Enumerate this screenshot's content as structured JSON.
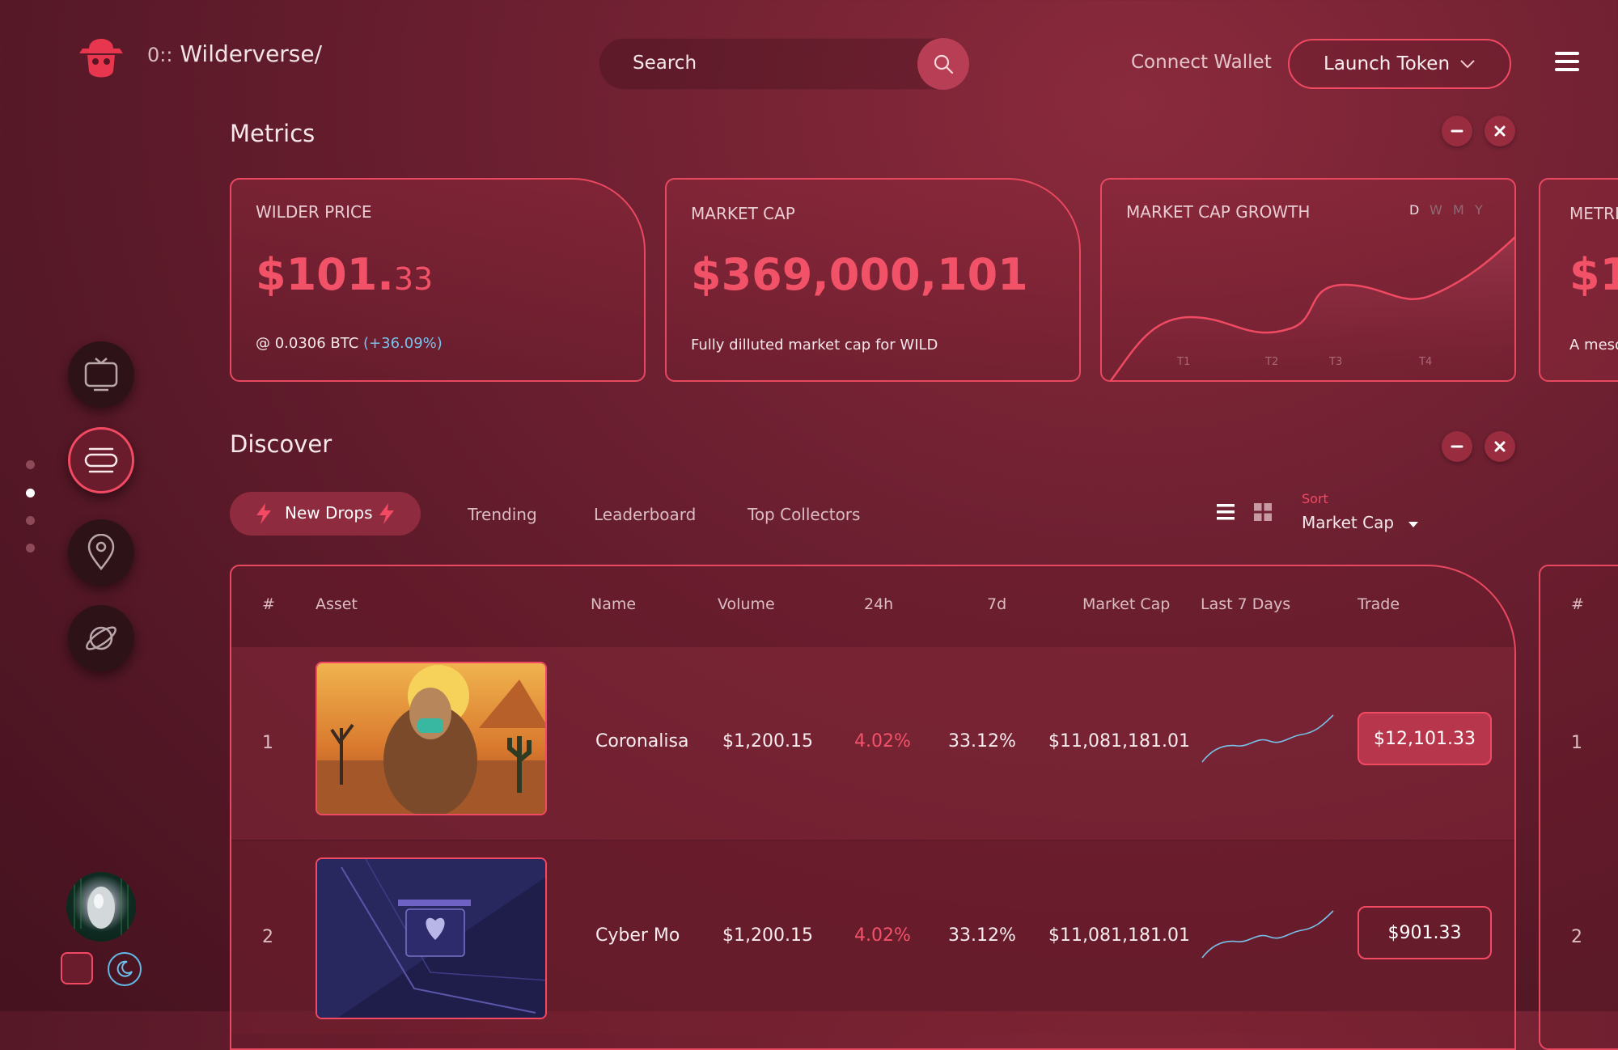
{
  "header": {
    "brand_prefix": "0::",
    "brand_name": "Wilderverse/",
    "search_placeholder": "Search",
    "connect_wallet": "Connect Wallet",
    "launch_token": "Launch Token"
  },
  "metrics": {
    "title": "Metrics",
    "cards": [
      {
        "label": "WILDER PRICE",
        "value_main": "$101.",
        "value_small": "33",
        "sub_prefix": "@ 0.0306 BTC",
        "sub_change": "(+36.09%)"
      },
      {
        "label": "MARKET CAP",
        "value": "$369,000,101",
        "sub": "Fully dilluted market cap for WILD"
      },
      {
        "label": "MARKET CAP GROWTH",
        "ranges": [
          "D",
          "W",
          "M",
          "Y"
        ],
        "active_range": "D",
        "x_labels": [
          "T1",
          "T2",
          "T3",
          "T4"
        ]
      },
      {
        "label": "METRI",
        "value": "$1",
        "sub": "A meso"
      }
    ]
  },
  "discover": {
    "title": "Discover",
    "tabs": [
      "New Drops",
      "Trending",
      "Leaderboard",
      "Top Collectors"
    ],
    "active_tab": "New Drops",
    "sort_label": "Sort",
    "sort_value": "Market Cap",
    "columns": [
      "#",
      "Asset",
      "Name",
      "Volume",
      "24h",
      "7d",
      "Market Cap",
      "Last 7 Days",
      "Trade"
    ],
    "rows": [
      {
        "rank": "1",
        "name": "Coronalisa",
        "volume": "$1,200.15",
        "change_24h": "4.02%",
        "change_7d": "33.12%",
        "market_cap": "$11,081,181.01",
        "trade": "$12,101.33"
      },
      {
        "rank": "2",
        "name": "Cyber Mo",
        "volume": "$1,200.15",
        "change_24h": "4.02%",
        "change_7d": "33.12%",
        "market_cap": "$11,081,181.01",
        "trade": "$901.33"
      }
    ],
    "peek_header": "#",
    "peek_ranks": [
      "1",
      "2"
    ]
  },
  "colors": {
    "accent": "#f24a63",
    "positive_blue": "#79c1ea",
    "background": "#6e2031"
  },
  "icons": [
    "logo-icon",
    "search-icon",
    "chevron-down-icon",
    "menu-icon",
    "tv-icon",
    "stack-icon",
    "location-icon",
    "planet-icon",
    "moon-icon",
    "minimize-icon",
    "close-icon",
    "lightning-icon",
    "list-view-icon",
    "grid-view-icon",
    "caret-down-icon"
  ]
}
